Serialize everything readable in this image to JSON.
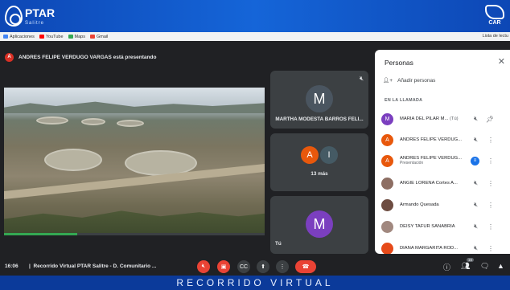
{
  "brand": {
    "logo_text": "PTAR",
    "logo_sub": "Salitre",
    "partner_logo": "CAR"
  },
  "bookmarks": {
    "items": [
      {
        "label": "Aplicaciones",
        "icon": "apps-icon",
        "color": "#4285f4"
      },
      {
        "label": "YouTube",
        "icon": "youtube-icon",
        "color": "#ff0000"
      },
      {
        "label": "Maps",
        "icon": "maps-icon",
        "color": "#34a853"
      },
      {
        "label": "Gmail",
        "icon": "gmail-icon",
        "color": "#ea4335"
      }
    ],
    "reading_list": "Lista de lectu"
  },
  "presenter": {
    "initial": "A",
    "text": "ANDRES FELIPE VERDUGO VARGAS está presentando"
  },
  "video": {
    "progress": 0.28
  },
  "tiles": [
    {
      "initial": "M",
      "name": "MARTHA MODESTA BARROS FELI...",
      "color": "#4a5560"
    },
    {
      "initials": [
        "A",
        "I"
      ],
      "label": "13 más",
      "colors": [
        "#e8580c",
        "#455a64"
      ]
    },
    {
      "initial": "M",
      "name": "Tú",
      "color": "#7b3fbf"
    }
  ],
  "panel": {
    "title": "Personas",
    "add_label": "Añadir personas",
    "section": "EN LA LLAMADA",
    "people": [
      {
        "initial": "M",
        "name": "MARIA DEL PILAR M...",
        "tag": "(Tú)",
        "sub": "",
        "color": "#7b3fbf",
        "mic": "mic-off-icon",
        "action": "pin-icon"
      },
      {
        "initial": "A",
        "name": "ANDRES FELIPE VERDUG...",
        "tag": "",
        "sub": "",
        "color": "#e8580c",
        "mic": "mic-off-icon",
        "action": "more-icon"
      },
      {
        "initial": "A",
        "name": "ANDRES FELIPE VERDUG...",
        "tag": "",
        "sub": "Presentación",
        "color": "#e8580c",
        "mic": "speaking-icon",
        "action": "more-icon"
      },
      {
        "initial": "",
        "name": "ANGIE LORENA Cortes A...",
        "tag": "",
        "sub": "",
        "color": "#8d6e63",
        "mic": "mic-off-icon",
        "action": "more-icon"
      },
      {
        "initial": "",
        "name": "Armando Quesada",
        "tag": "",
        "sub": "",
        "color": "#6d4c41",
        "mic": "mic-off-icon",
        "action": "more-icon"
      },
      {
        "initial": "",
        "name": "DEISY TAFUR SANABRIA",
        "tag": "",
        "sub": "",
        "color": "#a1887f",
        "mic": "mic-off-icon",
        "action": "more-icon"
      },
      {
        "initial": "",
        "name": "DIANA MARGARITA ROD...",
        "tag": "",
        "sub": "",
        "color": "#e64a19",
        "mic": "mic-off-icon",
        "action": "more-icon"
      }
    ]
  },
  "bottom_bar": {
    "time": "16:06",
    "meeting": "Recorrido Virtual PTAR Salitre - D. Comunitario ...",
    "participants_count": "16"
  },
  "footer": {
    "text": "RECORRIDO VIRTUAL"
  }
}
